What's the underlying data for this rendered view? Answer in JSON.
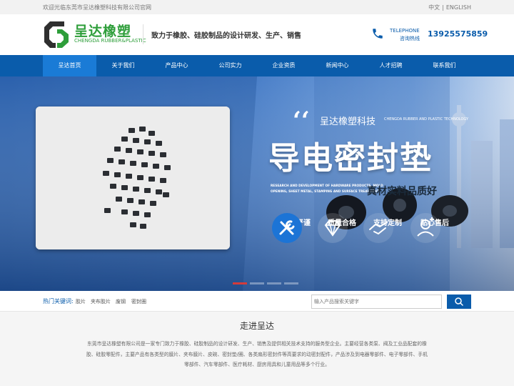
{
  "topbar": {
    "welcome": "欢迎光临东莞市呈达橡塑科技有限公司官网",
    "lang_cn": "中文",
    "lang_sep": "|",
    "lang_en": "ENGLISH"
  },
  "header": {
    "logo_cn": "呈达橡塑",
    "logo_en": "CHENGDA RUBBER&PLASTIC",
    "slogan": "致力于橡胶、硅胶制品的设计研发、生产、销售",
    "tel_label": "TELEPHONE",
    "tel_sub": "咨询热线",
    "tel_number": "13925575859"
  },
  "nav": {
    "items": [
      {
        "label": "呈达首页",
        "active": true
      },
      {
        "label": "关于我们"
      },
      {
        "label": "产品中心"
      },
      {
        "label": "公司实力"
      },
      {
        "label": "企业资质"
      },
      {
        "label": "新闻中心"
      },
      {
        "label": "人才招聘"
      },
      {
        "label": "联系我们"
      }
    ]
  },
  "banner": {
    "quote": "‘‘",
    "company": "呈达橡塑科技",
    "company_en": "CHENGDA RUBBER AND PLASTIC TECHNOLOGY",
    "headline": "导电密封垫",
    "desc_line1": "RESEARCH AND DEVELOPMENT OF HARDWARE PRODUCTS, MOLD",
    "desc_line2": "OPENING, SHEET METAL, STAMPING AND SURFACE TREATMENT",
    "slogan": "真材实料品质好",
    "features": [
      {
        "label": "工艺严谨",
        "icon": "tools-icon"
      },
      {
        "label": "质量合格",
        "icon": "diamond-icon"
      },
      {
        "label": "支持定制",
        "icon": "handshake-icon"
      },
      {
        "label": "贴心售后",
        "icon": "service-icon"
      }
    ],
    "colors": {
      "accent": "#d23b3b",
      "primary": "#0a5cab"
    }
  },
  "search": {
    "keywords_title": "热门关键词:",
    "keywords": [
      "胶片",
      "夹布胶片",
      "废钢",
      "密封圈"
    ],
    "placeholder": "输入产品搜索关键字",
    "button_icon": "search-icon"
  },
  "about": {
    "title": "走进呈达",
    "text": "东莞市呈达橡塑有限公司是一家专门致力于橡胶、硅胶制品的设计研发、生产、销售及提供相关技术支持的服务型企业。主要经营各类泵、阀及工业品配套的橡胶、硅胶零配件，主要产品有各类型的膜片、夹布膜片、皮碗、密封垫/圈、各类扇形密封件等高要求的动密封配件，产品涉及到电器零部件、电子零部件、手机零部件、汽车零部件、医疗耗材、厨房用具和儿童用品等多个行业。"
  }
}
